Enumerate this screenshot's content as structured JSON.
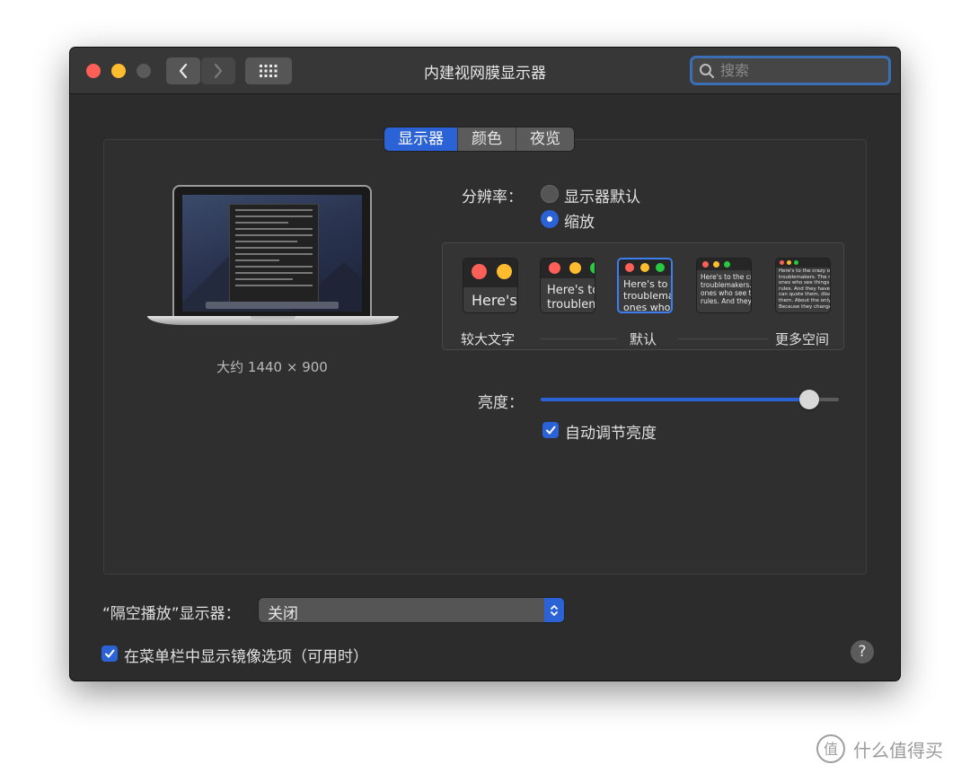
{
  "window": {
    "title": "内建视网膜显示器"
  },
  "toolbar": {
    "back_icon": "chevron-left-icon",
    "forward_icon": "chevron-right-icon",
    "grid_icon": "grid-icon"
  },
  "search": {
    "placeholder": "搜索"
  },
  "tabs": [
    {
      "label": "显示器",
      "selected": true
    },
    {
      "label": "颜色",
      "selected": false
    },
    {
      "label": "夜览",
      "selected": false
    }
  ],
  "display": {
    "caption": "大约 1440 × 900"
  },
  "resolution": {
    "label": "分辨率：",
    "options": [
      {
        "label": "显示器默认",
        "selected": false
      },
      {
        "label": "缩放",
        "selected": true
      }
    ]
  },
  "scaling": {
    "thumbs": [
      {
        "text": "Here's"
      },
      {
        "text": "Here's to\ntroublem"
      },
      {
        "text": "Here's to t\ntroublema\nones who"
      },
      {
        "text": "Here's to the cr\ntroublemakers.\nones who see t\nrules. And they"
      },
      {
        "text": "Here's to the crazy one\ntroublemakers. The rou\nones who see things dif\nrules. And they have no\ncan quote them, disagre\nthem. About the only th\nBecause they change it"
      }
    ],
    "left_label": "较大文字",
    "center_label": "默认",
    "right_label": "更多空间",
    "selected_index": 2
  },
  "brightness": {
    "label": "亮度：",
    "value_fraction": 0.9,
    "auto_label": "自动调节亮度",
    "auto_checked": true
  },
  "airplay": {
    "label": "“隔空播放”显示器：",
    "value": "关闭"
  },
  "mirror": {
    "label": "在菜单栏中显示镜像选项（可用时）",
    "checked": true
  },
  "help": {
    "label": "?"
  },
  "watermark": {
    "text": "什么值得买",
    "badge": "值"
  },
  "colors": {
    "accent": "#2b62d6",
    "close": "#fe5f57",
    "minimize": "#febc2e",
    "background": "#2c2c2c"
  }
}
